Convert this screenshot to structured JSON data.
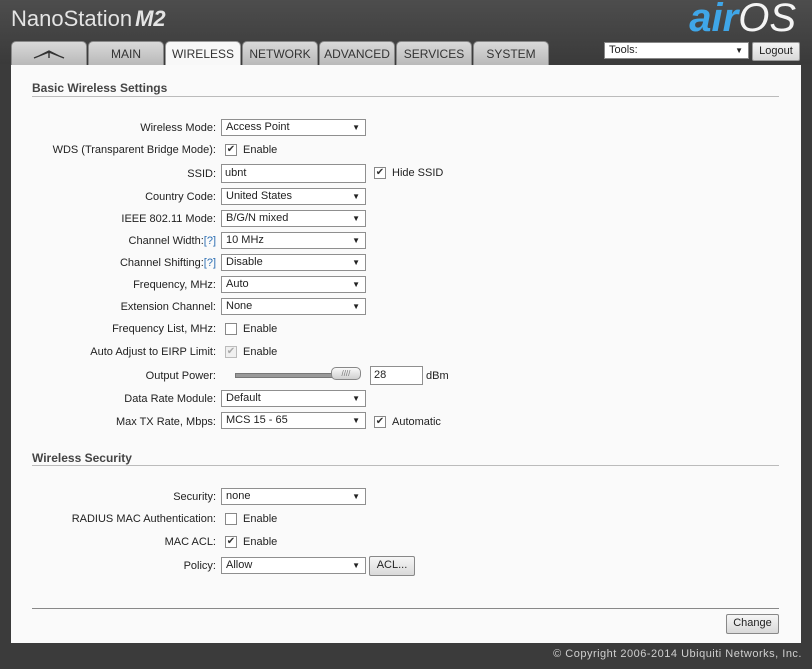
{
  "header": {
    "product": "NanoStation",
    "model": "M2",
    "brand_air": "air",
    "brand_os": "OS",
    "tabs": [
      {
        "label": "",
        "icon": "ubiquiti-logo-icon"
      },
      {
        "label": "MAIN"
      },
      {
        "label": "WIRELESS"
      },
      {
        "label": "NETWORK"
      },
      {
        "label": "ADVANCED"
      },
      {
        "label": "SERVICES"
      },
      {
        "label": "SYSTEM"
      }
    ],
    "tools_label": "Tools:",
    "logout_label": "Logout"
  },
  "basic": {
    "title": "Basic Wireless Settings",
    "wireless_mode": {
      "label": "Wireless Mode:",
      "value": "Access Point"
    },
    "wds": {
      "label": "WDS (Transparent Bridge Mode):",
      "check_label": "Enable",
      "checked": true
    },
    "ssid": {
      "label": "SSID:",
      "value": "ubnt",
      "hide_label": "Hide SSID",
      "hide_checked": true
    },
    "country": {
      "label": "Country Code:",
      "value": "United States"
    },
    "ieee": {
      "label": "IEEE 802.11 Mode:",
      "value": "B/G/N mixed"
    },
    "channel_width": {
      "label": "Channel Width:",
      "help": "[?]",
      "value": "10 MHz"
    },
    "channel_shifting": {
      "label": "Channel Shifting:",
      "help": "[?]",
      "value": "Disable"
    },
    "frequency": {
      "label": "Frequency, MHz:",
      "value": "Auto"
    },
    "extension": {
      "label": "Extension Channel:",
      "value": "None"
    },
    "freq_list": {
      "label": "Frequency List, MHz:",
      "check_label": "Enable",
      "checked": false
    },
    "eirp": {
      "label": "Auto Adjust to EIRP Limit:",
      "check_label": "Enable",
      "checked": true
    },
    "output_power": {
      "label": "Output Power:",
      "value": "28",
      "unit": "dBm",
      "slider_fraction": 0.93
    },
    "data_rate": {
      "label": "Data Rate Module:",
      "value": "Default"
    },
    "max_tx": {
      "label": "Max TX Rate, Mbps:",
      "value": "MCS 15 - 65",
      "auto_label": "Automatic",
      "auto_checked": true
    }
  },
  "security": {
    "title": "Wireless Security",
    "security": {
      "label": "Security:",
      "value": "none"
    },
    "radius": {
      "label": "RADIUS MAC Authentication:",
      "check_label": "Enable",
      "checked": false
    },
    "mac_acl": {
      "label": "MAC ACL:",
      "check_label": "Enable",
      "checked": true
    },
    "policy": {
      "label": "Policy:",
      "value": "Allow",
      "acl_button": "ACL..."
    }
  },
  "change_label": "Change",
  "copyright": "© Copyright 2006-2014 Ubiquiti Networks, Inc.",
  "colors": {
    "brand_blue": "#3fa6e8",
    "header_bg": "#3b3b3b",
    "content_bg": "#fafafa"
  }
}
